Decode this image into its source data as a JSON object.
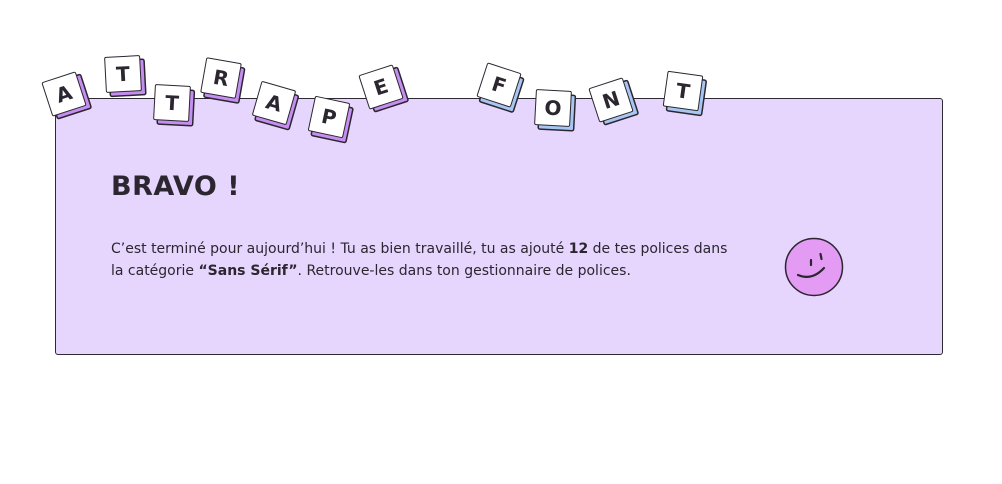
{
  "brand": {
    "word1": [
      "A",
      "T",
      "T",
      "R",
      "A",
      "P",
      "E"
    ],
    "word2": [
      "F",
      "O",
      "N",
      "T"
    ]
  },
  "card": {
    "title": "BRAVO !",
    "message": {
      "part1": "C’est terminé pour aujourd’hui ! Tu as bien travaillé, tu as ajouté ",
      "count": "12",
      "part2": " de tes polices dans la catégorie ",
      "category": "“Sans Sérif”",
      "part3": ". Retrouve-les dans ton gestionnaire de polices."
    }
  },
  "icons": {
    "smiley": "smiley-face-icon"
  },
  "colors": {
    "panel_bg": "#e6d5fd",
    "tile_shadow_purple": "#c58ef0",
    "tile_shadow_blue": "#a7c7f2",
    "smiley_fill": "#e39bf4",
    "text": "#2b2630"
  }
}
